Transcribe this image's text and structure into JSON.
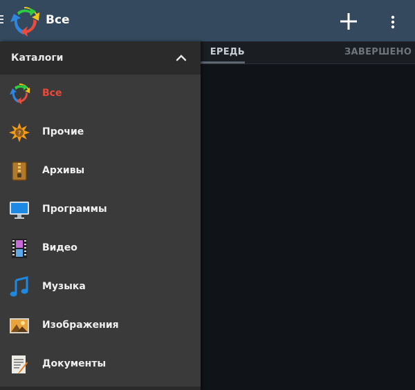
{
  "appbar": {
    "title": "Все",
    "icons": {
      "menu": "hamburger-icon",
      "logo": "recycle-arrows-logo",
      "add": "plus-icon",
      "more": "more-vert-icon"
    }
  },
  "tabs": [
    {
      "label": "ЕРЕДЬ",
      "active": true
    },
    {
      "label": "ЗАВЕРШЕНО",
      "active": false
    }
  ],
  "drawer": {
    "header_label": "Каталоги",
    "items": [
      {
        "label": "Все",
        "icon": "all-icon",
        "active": true
      },
      {
        "label": "Прочие",
        "icon": "other-icon",
        "active": false
      },
      {
        "label": "Архивы",
        "icon": "archive-icon",
        "active": false
      },
      {
        "label": "Программы",
        "icon": "programs-icon",
        "active": false
      },
      {
        "label": "Видео",
        "icon": "video-icon",
        "active": false
      },
      {
        "label": "Музыка",
        "icon": "music-icon",
        "active": false
      },
      {
        "label": "Изображения",
        "icon": "images-icon",
        "active": false
      },
      {
        "label": "Документы",
        "icon": "documents-icon",
        "active": false
      }
    ]
  },
  "colors": {
    "appbar": "#34495e",
    "drawer": "#3a3a3a",
    "drawer_header": "#2b2b2b",
    "content_bg": "#101318",
    "active_text": "#e84a3b"
  }
}
